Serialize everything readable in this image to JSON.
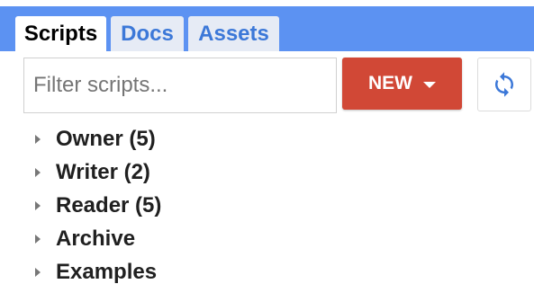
{
  "tabs": [
    {
      "label": "Scripts",
      "active": true
    },
    {
      "label": "Docs",
      "active": false
    },
    {
      "label": "Assets",
      "active": false
    }
  ],
  "toolbar": {
    "filter_placeholder": "Filter scripts...",
    "filter_value": "",
    "new_label": "NEW",
    "new_icon": "caret-down-icon",
    "refresh_icon": "refresh-icon"
  },
  "tree": {
    "items": [
      {
        "label": "Owner (5)",
        "icon": "expand-arrow-icon"
      },
      {
        "label": "Writer (2)",
        "icon": "expand-arrow-icon"
      },
      {
        "label": "Reader (5)",
        "icon": "expand-arrow-icon"
      },
      {
        "label": "Archive",
        "icon": "expand-arrow-icon"
      },
      {
        "label": "Examples",
        "icon": "expand-arrow-icon"
      }
    ]
  },
  "colors": {
    "tab_bar": "#5c92f2",
    "tab_inactive_text": "#3c78d8",
    "new_button": "#d14836",
    "refresh_icon": "#3c78d8"
  }
}
